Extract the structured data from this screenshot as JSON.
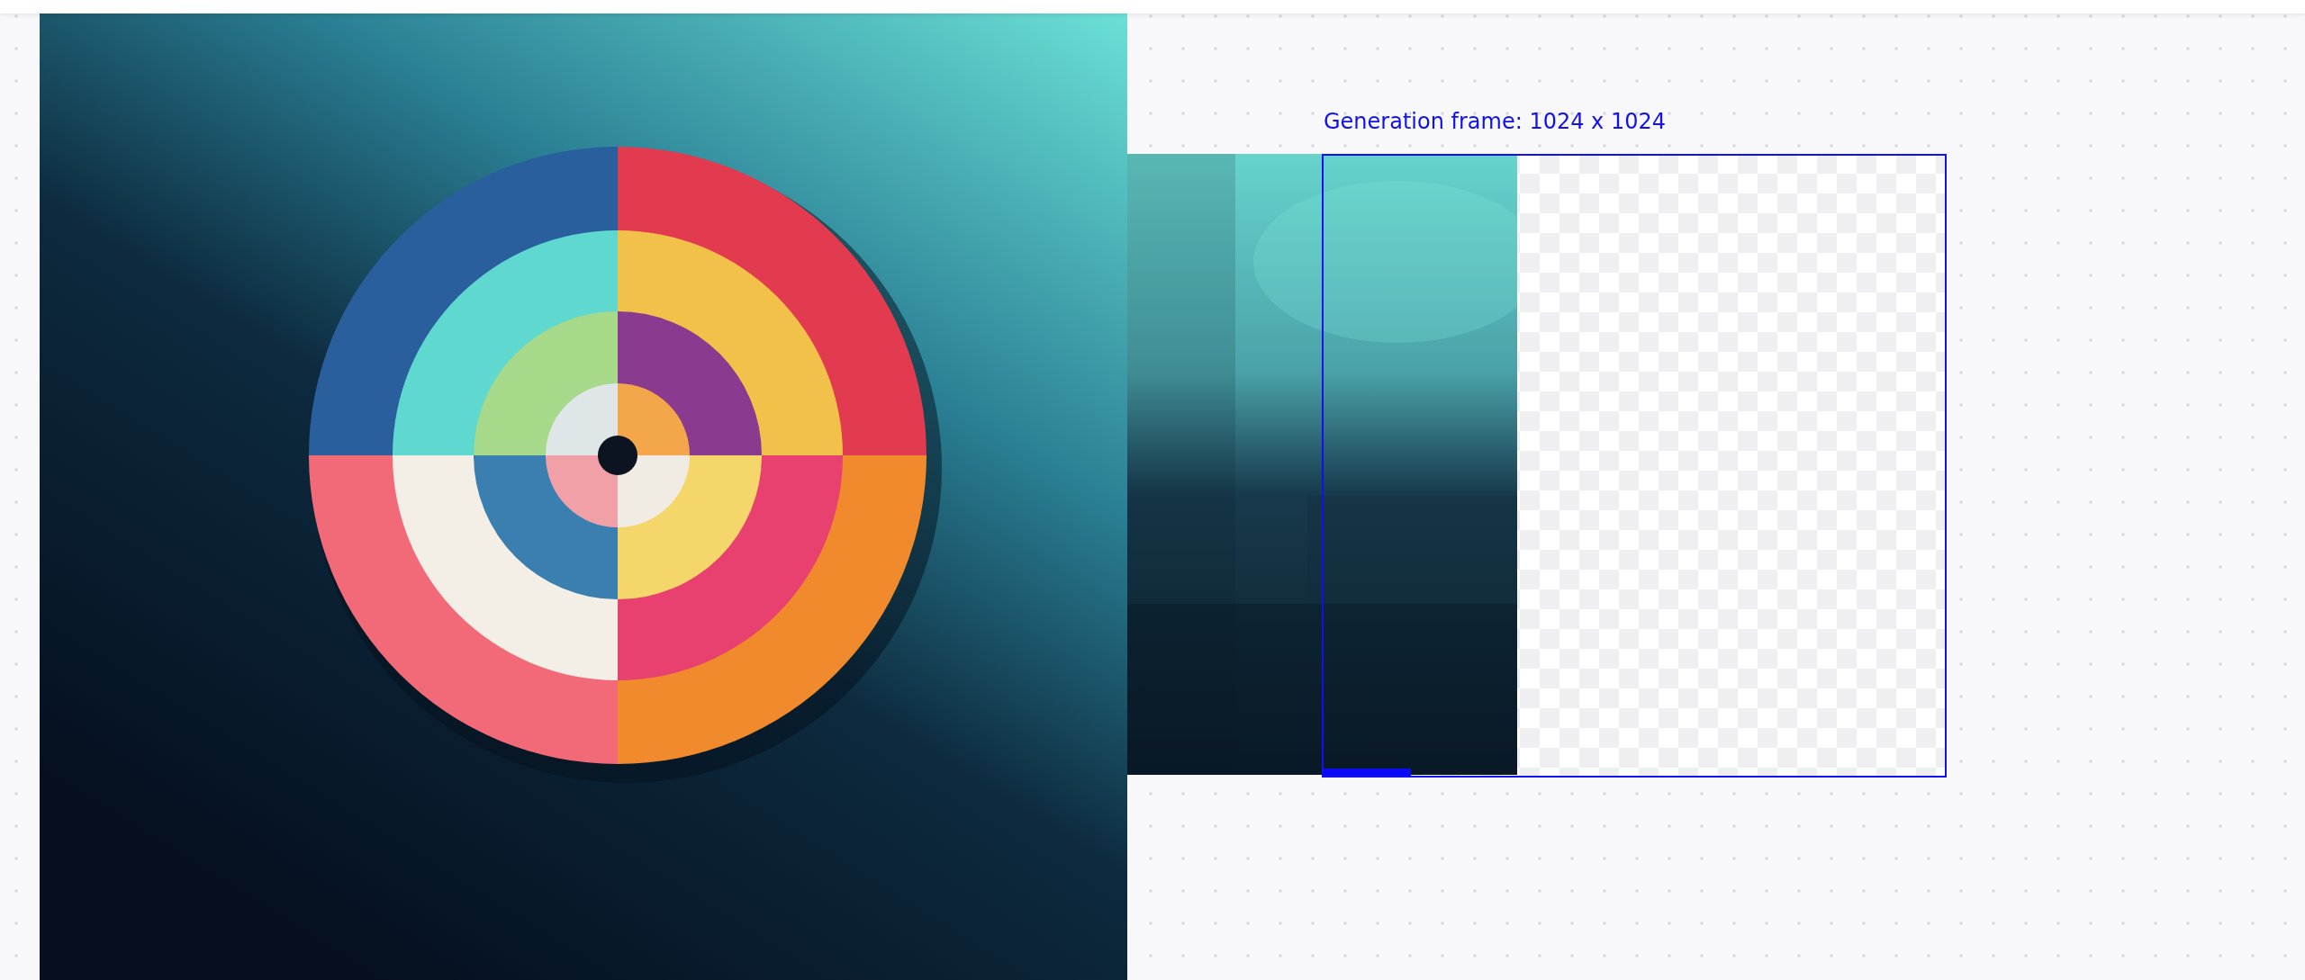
{
  "canvas": {
    "frame": {
      "label": "Generation frame: 1024 x 1024",
      "level": 0.14
    }
  }
}
